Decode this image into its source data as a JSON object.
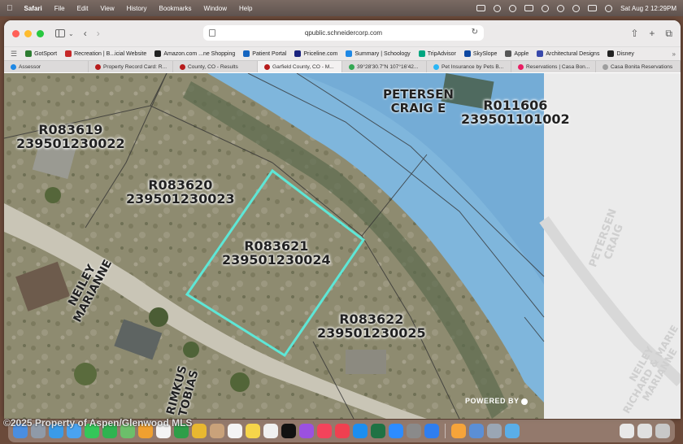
{
  "menubar": {
    "app_name": "Safari",
    "items": [
      "File",
      "Edit",
      "View",
      "History",
      "Bookmarks",
      "Window",
      "Help"
    ],
    "datetime": "Sat Aug 2  12:29PM"
  },
  "toolbar": {
    "url": "qpublic.schneidercorp.com"
  },
  "bookmarks": [
    {
      "label": "GotSport",
      "color": "#2e7d32"
    },
    {
      "label": "Recreation | B...icial Website",
      "color": "#c62828"
    },
    {
      "label": "Amazon.com ...ne Shopping",
      "color": "#222222"
    },
    {
      "label": "Patient Portal",
      "color": "#1565c0"
    },
    {
      "label": "Priceline.com",
      "color": "#1a237e"
    },
    {
      "label": "Summary | Schoology",
      "color": "#1e88e5"
    },
    {
      "label": "TripAdvisor",
      "color": "#00a680"
    },
    {
      "label": "SkySlope",
      "color": "#0d47a1"
    },
    {
      "label": "Apple",
      "color": "#555555"
    },
    {
      "label": "Architectural Designs",
      "color": "#3949ab"
    },
    {
      "label": "Disney",
      "color": "#222222"
    }
  ],
  "tabs": [
    {
      "label": "Assessor",
      "color": "#1e88e5",
      "active": false
    },
    {
      "label": "Property Record Card: R...",
      "color": "#b71c1c",
      "active": false
    },
    {
      "label": "County, CO - Results",
      "color": "#b71c1c",
      "active": false
    },
    {
      "label": "Garfield County, CO - M...",
      "color": "#b71c1c",
      "active": true
    },
    {
      "label": "39°28'30.7\"N 107°16'42...",
      "color": "#34a853",
      "active": false
    },
    {
      "label": "Pet Insurance by Pets B...",
      "color": "#29b6f6",
      "active": false
    },
    {
      "label": "Reservations | Casa Bon...",
      "color": "#e91e63",
      "active": false
    },
    {
      "label": "Casa Bonita Reservations",
      "color": "#9e9e9e",
      "active": false
    }
  ],
  "map": {
    "parcels": [
      {
        "id": "R083619",
        "number": "239501230022"
      },
      {
        "id": "R083620",
        "number": "239501230023"
      },
      {
        "id": "R083621",
        "number": "239501230024"
      },
      {
        "id": "R083622",
        "number": "239501230025"
      },
      {
        "id": "R011606",
        "number": "239501101002"
      }
    ],
    "owners": {
      "petersen_line1": "PETERSEN",
      "petersen_line2": "CRAIG E",
      "neiley_line1": "NEILEY",
      "neiley_line2": "MARIANNE",
      "rimkus_line1": "RIMKUS",
      "rimkus_line2": "TOBIAS",
      "faded_petersen_line1": "PETERSEN",
      "faded_petersen_line2": "CRAIG",
      "faded_neiley_line1": "NEILEY",
      "faded_neiley_line2": "RICHARD & MARIE",
      "faded_neiley_line3": "MARIANNE"
    },
    "powered_by": "POWERED BY",
    "highlight_color": "#5ee6d6"
  },
  "watermark": "©2025 Property of Aspen/Glenwood MLS"
}
